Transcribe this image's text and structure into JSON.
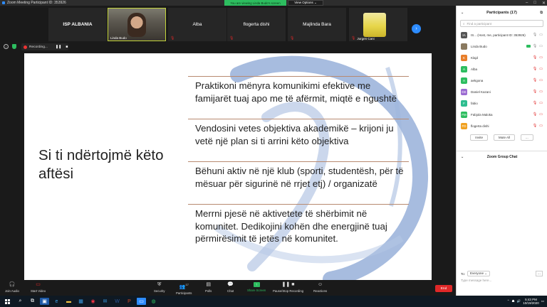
{
  "window": {
    "title": "Zoom Meeting Participant ID: 353926"
  },
  "banner": {
    "viewing": "You are viewing Linda Budo's screen",
    "view_options": "View Options ⌄"
  },
  "gallery": {
    "tiles": [
      {
        "name": "ISP ALBANIA",
        "type": "text"
      },
      {
        "name": "Linda Budo",
        "type": "video"
      },
      {
        "name": "Alba",
        "type": "text"
      },
      {
        "name": "flogerta dishi",
        "type": "text"
      },
      {
        "name": "Majlinda Bara",
        "type": "text"
      },
      {
        "name": "Jurgen Cani",
        "type": "photo"
      }
    ]
  },
  "recording": {
    "label": "Recording..."
  },
  "slide": {
    "title": "Si ti ndërtojmë këto aftësi",
    "items": [
      "Praktikoni mënyra komunikimi efektive me famijarët tuaj apo me të afërmit, miqtë e ngushtë",
      "Vendosini vetes objektiva akademikë – krijoni ju vetë një plan si ti arrini këto objektiva",
      "Bëhuni aktiv në një klub (sporti, studentësh, për të mësuar për sigurinë në rrjet etj) / organizatë",
      "Merrni pjesë në aktivetete të shërbimit në komunitet. Dedikojini kohën dhe energjinë tuaj përmirësimit të jetës në komunitet."
    ]
  },
  "participants": {
    "header": "Participants (17)",
    "search_placeholder": "Find a participant",
    "list": [
      {
        "initials": "IA",
        "name": "IS... (Host, me, participant ID: 353926)",
        "color": "#555555"
      },
      {
        "initials": "",
        "name": "Linda Budo",
        "color": "#8a7a60"
      },
      {
        "initials": "K",
        "name": "Klajd",
        "color": "#e87e2a"
      },
      {
        "initials": "A",
        "name": "Alba",
        "color": "#2dbd5f"
      },
      {
        "initials": "A",
        "name": "aekgona",
        "color": "#2dbd5f"
      },
      {
        "initials": "DK",
        "name": "Daniel Kazani",
        "color": "#9b6bd1"
      },
      {
        "initials": "F",
        "name": "fabio",
        "color": "#2dbd8f"
      },
      {
        "initials": "FM",
        "name": "Fabjola Maloka",
        "color": "#2dbd5f"
      },
      {
        "initials": "FD",
        "name": "flogerta dishi",
        "color": "#f0a020"
      }
    ],
    "invite": "Invite",
    "mute_all": "Mute All",
    "more": "..."
  },
  "chat": {
    "header": "Zoom Group Chat",
    "to_label": "To:",
    "to_value": "Everyone ⌄",
    "more": "...",
    "placeholder": "Type message here..."
  },
  "toolbar": {
    "join_audio": "Join Audio",
    "start_video": "Start Video",
    "security": "Security",
    "participants": "Participants",
    "participants_count": "17",
    "polls": "Polls",
    "chat": "Chat",
    "share_screen": "Share Screen",
    "pause_recording": "Pause/Stop Recording",
    "reactions": "Reactions",
    "end": "End"
  },
  "taskbar": {
    "time": "5:43 PM",
    "date": "10/19/2020"
  }
}
